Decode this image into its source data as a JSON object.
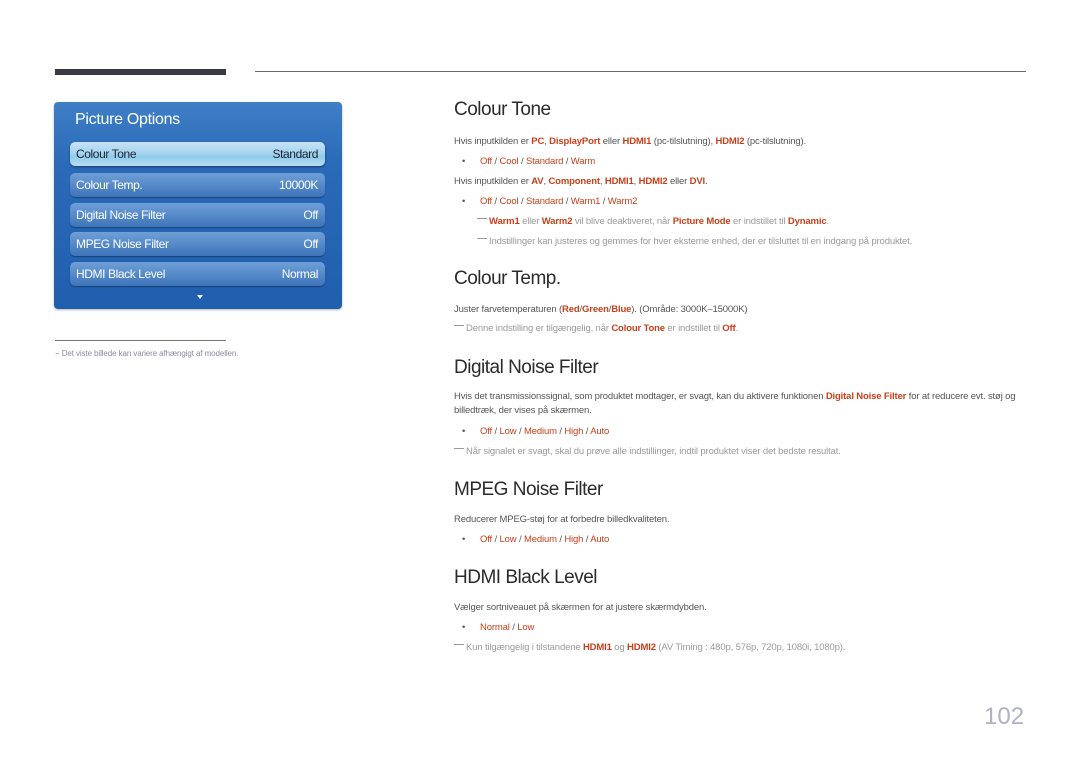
{
  "osd": {
    "title": "Picture Options",
    "items": [
      {
        "label": "Colour Tone",
        "value": "Standard",
        "selected": true
      },
      {
        "label": "Colour Temp.",
        "value": "10000K",
        "selected": false
      },
      {
        "label": "Digital Noise Filter",
        "value": "Off",
        "selected": false
      },
      {
        "label": "MPEG Noise Filter",
        "value": "Off",
        "selected": false
      },
      {
        "label": "HDMI Black Level",
        "value": "Normal",
        "selected": false
      }
    ],
    "more_icon": "triangle-down-icon"
  },
  "footnote": "−  Det viste billede kan variere afhængigt af modellen.",
  "sections": {
    "colour_tone": {
      "title": "Colour Tone",
      "line1": {
        "pre": "Hvis inputkilden er ",
        "pc": "PC",
        "sep1": ", ",
        "dp": "DisplayPort",
        "mid": " eller ",
        "hdmi1": "HDMI1",
        "paren1": " (pc-tilslutning), ",
        "hdmi2": "HDMI2",
        "paren2": " (pc-tilslutning)."
      },
      "options1": [
        "Off",
        "Cool",
        "Standard",
        "Warm"
      ],
      "line2": {
        "pre": "Hvis inputkilden er ",
        "av": "AV",
        "sep1": ", ",
        "comp": "Component",
        "sep2": ", ",
        "hdmi1": "HDMI1",
        "sep3": ", ",
        "hdmi2": "HDMI2",
        "mid": "  eller ",
        "dvi": "DVI",
        "end": "."
      },
      "options2": [
        "Off",
        "Cool",
        "Standard",
        "Warm1",
        "Warm2"
      ],
      "note1": {
        "w1": "Warm1",
        "t1": " eller ",
        "w2": "Warm2",
        "t2": " vil blive deaktiveret, når ",
        "pm": "Picture Mode",
        "t3": " er indstillet til ",
        "dyn": "Dynamic",
        "end": "."
      },
      "note2": "Indstillinger kan justeres og gemmes for hver eksterne enhed, der er tilsluttet til en indgang på produktet."
    },
    "colour_temp": {
      "title": "Colour Temp.",
      "line": {
        "pre": "Juster farvetemperaturen (",
        "red": "Red",
        "s1": "/",
        "green": "Green",
        "s2": "/",
        "blue": "Blue",
        "post": "). (Område: 3000K–15000K)"
      },
      "note": {
        "pre": "Denne indstilling er tilgængelig, når ",
        "ct": "Colour Tone",
        "mid": " er indstillet til ",
        "off": "Off",
        "end": "."
      }
    },
    "digital_noise": {
      "title": "Digital Noise Filter",
      "line": {
        "pre": "Hvis det transmissionssignal, som produktet modtager, er svagt, kan du aktivere funktionen ",
        "dnf": "Digital Noise Filter",
        "post": " for at reducere evt. støj og billedtræk, der vises på skærmen."
      },
      "options": [
        "Off",
        "Low",
        "Medium",
        "High",
        "Auto"
      ],
      "note": "Når signalet er svagt, skal du prøve alle indstillinger, indtil produktet viser det bedste resultat."
    },
    "mpeg_noise": {
      "title": "MPEG Noise Filter",
      "line": "Reducerer MPEG-støj for at forbedre billedkvaliteten.",
      "options": [
        "Off",
        "Low",
        "Medium",
        "High",
        "Auto"
      ]
    },
    "hdmi_black": {
      "title": "HDMI Black Level",
      "line": "Vælger sortniveauet på skærmen for at justere skærmdybden.",
      "options": [
        "Normal",
        "Low"
      ],
      "note": {
        "pre": "Kun tilgængelig i tilstandene ",
        "h1": "HDMI1",
        "mid": " og ",
        "h2": "HDMI2",
        "post": " (AV Timing : 480p, 576p, 720p, 1080i, 1080p)."
      }
    }
  },
  "bullet": "•",
  "separator": " / ",
  "page_number": "102",
  "colors": {
    "accent": "#c8401a",
    "panel_blue": "#1f5fae",
    "selected_item": "#a8d4ef"
  }
}
